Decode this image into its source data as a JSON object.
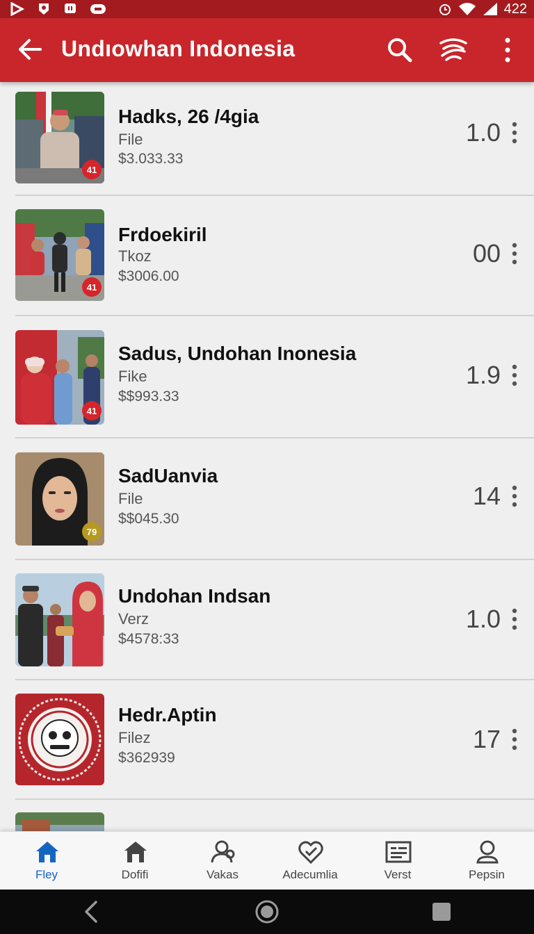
{
  "status_bar": {
    "left_icons": [
      "play-store-icon",
      "shield-icon",
      "message-icon",
      "game-icon"
    ],
    "right_icons": [
      "alarm-icon",
      "wifi-icon",
      "signal-icon"
    ],
    "time": "422"
  },
  "app_bar": {
    "title": "Undıowhan Indonesia",
    "actions": [
      "back-arrow-icon",
      "search-icon",
      "wifi-icon",
      "more-vert-icon"
    ]
  },
  "list": {
    "items": [
      {
        "title": "Hadks, 26 /4gia",
        "subtitle": "File",
        "price": "$3.033.33",
        "value": "1.0",
        "badge": "41"
      },
      {
        "title": "Frdoekiril",
        "subtitle": "Tkoz",
        "price": "$3006.00",
        "value": "00",
        "badge": "41"
      },
      {
        "title": "Sadus, Undohan Inonesia",
        "subtitle": "Fike",
        "price": "$$993.33",
        "value": "1.9",
        "badge": "41"
      },
      {
        "title": "SadUanvia",
        "subtitle": "File",
        "price": "$$045.30",
        "value": "14",
        "badge": "79"
      },
      {
        "title": "Undohan Indsan",
        "subtitle": "Verz",
        "price": "$4578:33",
        "value": "1.0",
        "badge": ""
      },
      {
        "title": "Hedr.Aptin",
        "subtitle": "Filez",
        "price": "$362939",
        "value": "17",
        "badge": ""
      }
    ]
  },
  "bottom_nav": {
    "items": [
      {
        "label": "Fley",
        "icon": "home-icon",
        "active": true
      },
      {
        "label": "Dofifi",
        "icon": "store-icon",
        "active": false
      },
      {
        "label": "Vakas",
        "icon": "people-icon",
        "active": false
      },
      {
        "label": "Adecumlia",
        "icon": "badge-check-icon",
        "active": false
      },
      {
        "label": "Verst",
        "icon": "list-card-icon",
        "active": false
      },
      {
        "label": "Pepsin",
        "icon": "person-icon",
        "active": false
      }
    ]
  },
  "colors": {
    "app_bar": "#c8262b",
    "status_bar": "#a31b1f",
    "active_nav": "#1565c0",
    "badge": "#d6252b"
  }
}
